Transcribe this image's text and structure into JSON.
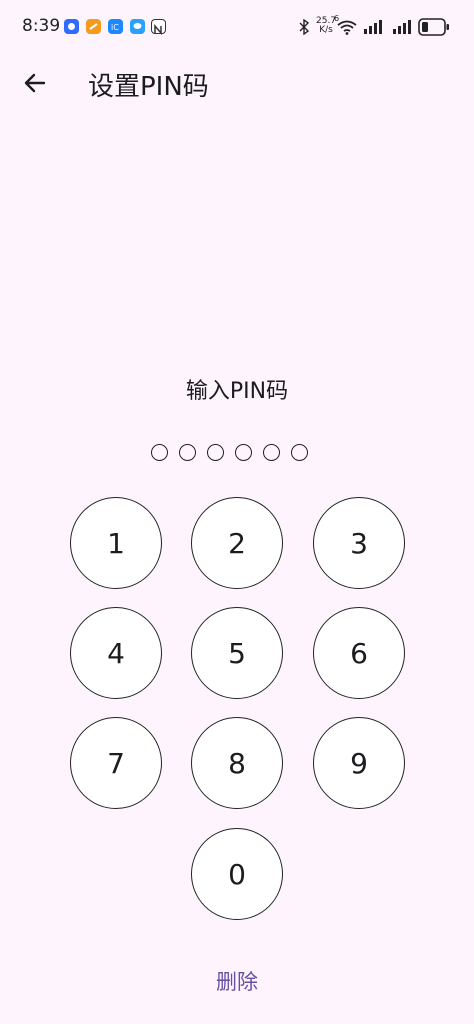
{
  "status_bar": {
    "time": "8:39",
    "net_speed_value": "25.7",
    "net_speed_unit": "K/s",
    "wifi_label": "6",
    "icons": [
      "bluetooth-icon",
      "wifi-icon",
      "signal-icon",
      "signal-icon",
      "battery-icon"
    ],
    "notification_colors": [
      "#2f6bff",
      "#f59a1b",
      "#1e88ff",
      "#2aa0ff",
      "#333333"
    ]
  },
  "header": {
    "title": "设置PIN码",
    "back_icon": "arrow-left-icon"
  },
  "prompt": "输入PIN码",
  "pin_length": 6,
  "keypad": {
    "keys": [
      "1",
      "2",
      "3",
      "4",
      "5",
      "6",
      "7",
      "8",
      "9",
      "0"
    ]
  },
  "delete_label": "删除",
  "colors": {
    "background": "#fdf4fd",
    "accent": "#6750a4",
    "key_fill": "#ffffff",
    "outline": "#222222"
  }
}
